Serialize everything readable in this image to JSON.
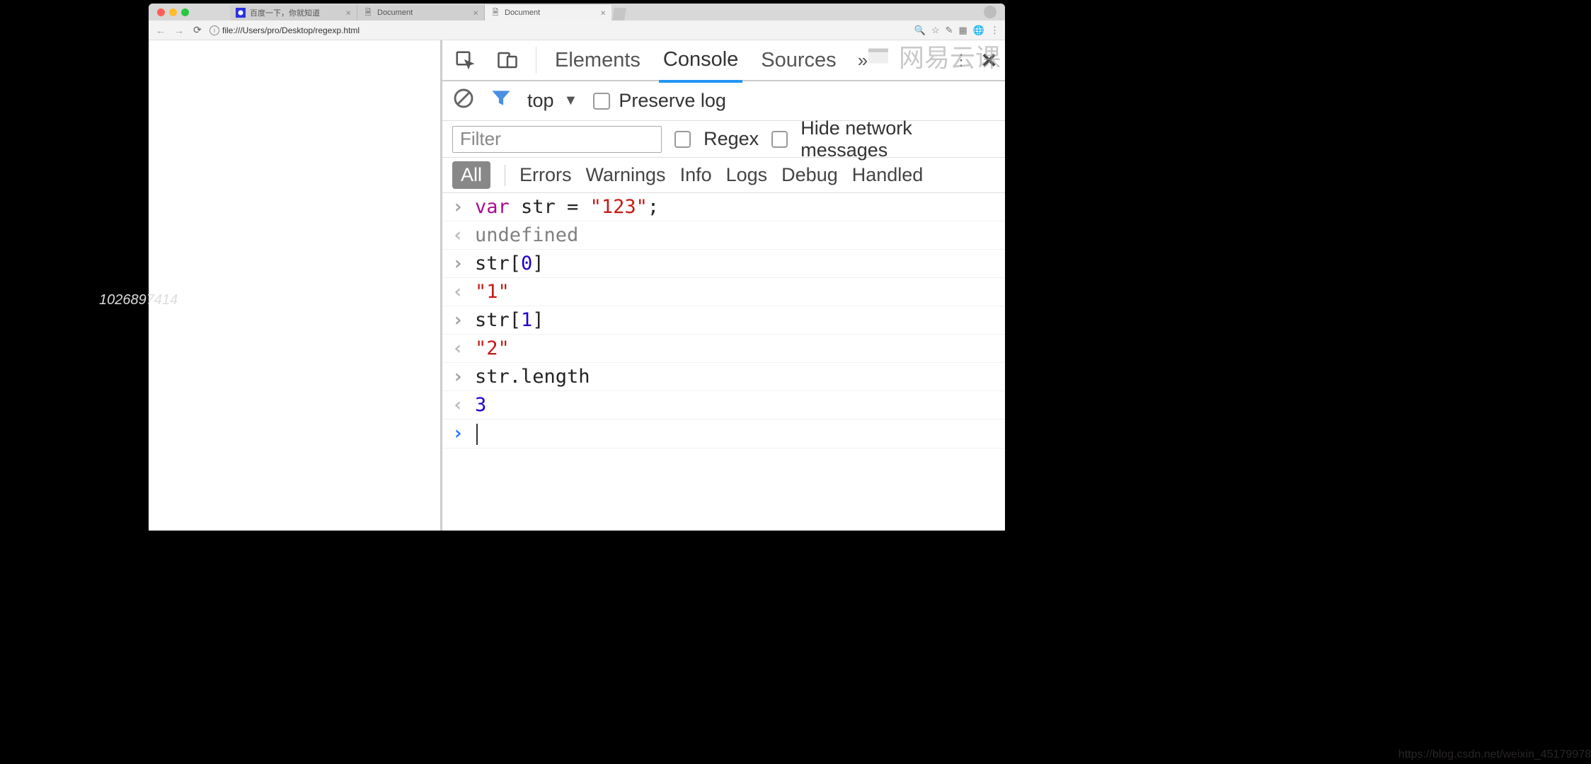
{
  "browser": {
    "tabs": [
      {
        "title": "百度一下，你就知道"
      },
      {
        "title": "Document"
      },
      {
        "title": "Document"
      }
    ],
    "url": "file:///Users/pro/Desktop/regexp.html"
  },
  "page": {
    "faded_text": "1026897414"
  },
  "devtools": {
    "tabs": {
      "elements": "Elements",
      "console": "Console",
      "sources": "Sources"
    },
    "toolbar": {
      "context": "top",
      "preserve_log": "Preserve log"
    },
    "filterbar": {
      "filter_placeholder": "Filter",
      "regex": "Regex",
      "hide_network": "Hide network messages"
    },
    "levelbar": {
      "all": "All",
      "errors": "Errors",
      "warnings": "Warnings",
      "info": "Info",
      "logs": "Logs",
      "debug": "Debug",
      "handled": "Handled"
    },
    "console": {
      "rows": [
        {
          "type": "input",
          "tokens": [
            {
              "c": "key",
              "t": "var"
            },
            {
              "c": "plain",
              "t": " str = "
            },
            {
              "c": "str",
              "t": "\"123\""
            },
            {
              "c": "plain",
              "t": ";"
            }
          ]
        },
        {
          "type": "output",
          "tokens": [
            {
              "c": "undef",
              "t": "undefined"
            }
          ]
        },
        {
          "type": "input",
          "tokens": [
            {
              "c": "plain",
              "t": "str["
            },
            {
              "c": "num",
              "t": "0"
            },
            {
              "c": "plain",
              "t": "]"
            }
          ]
        },
        {
          "type": "output",
          "tokens": [
            {
              "c": "strout",
              "t": "\"1\""
            }
          ]
        },
        {
          "type": "input",
          "tokens": [
            {
              "c": "plain",
              "t": "str["
            },
            {
              "c": "num",
              "t": "1"
            },
            {
              "c": "plain",
              "t": "]"
            }
          ]
        },
        {
          "type": "output",
          "tokens": [
            {
              "c": "strout",
              "t": "\"2\""
            }
          ]
        },
        {
          "type": "input",
          "tokens": [
            {
              "c": "plain",
              "t": "str.length"
            }
          ]
        },
        {
          "type": "output",
          "tokens": [
            {
              "c": "num",
              "t": "3"
            }
          ]
        }
      ]
    }
  },
  "watermark": {
    "logo_text": "网易云课",
    "footer": "https://blog.csdn.net/weixin_45179978"
  }
}
